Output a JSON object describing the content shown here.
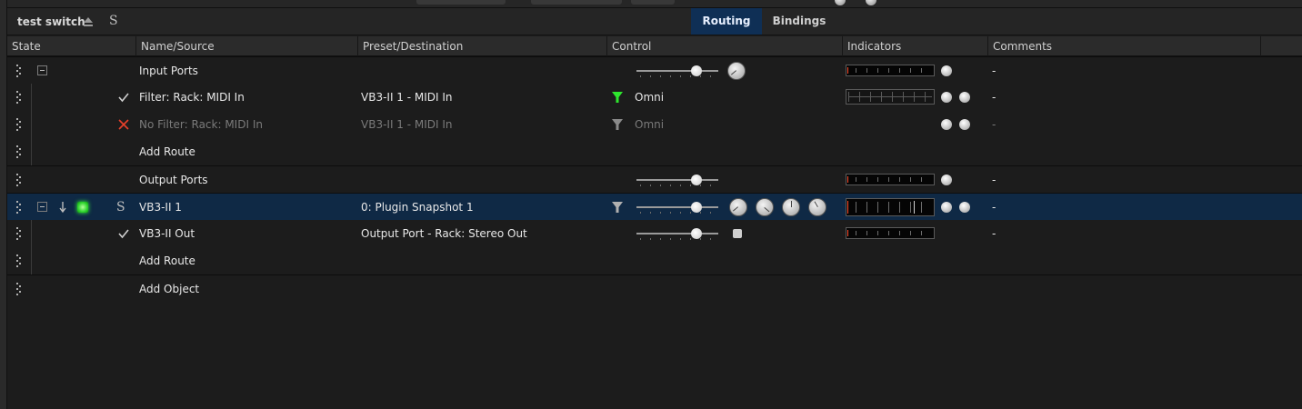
{
  "header": {
    "title": "test switch",
    "solo_label": "S",
    "tabs": [
      {
        "label": "Routing",
        "active": true
      },
      {
        "label": "Bindings",
        "active": false
      }
    ]
  },
  "columns": [
    "State",
    "Name/Source",
    "Preset/Destination",
    "Control",
    "Indicators",
    "Comments"
  ],
  "rows": [
    {
      "name": "Input Ports",
      "destination": "",
      "control": "",
      "comment": "-"
    },
    {
      "name": "Filter: Rack: MIDI In",
      "destination": "VB3-II 1 - MIDI In",
      "control": "Omni",
      "comment": "-"
    },
    {
      "name": "No Filter: Rack: MIDI In",
      "destination": "VB3-II 1 - MIDI In",
      "control": "Omni",
      "comment": "-"
    },
    {
      "name": "Add Route",
      "destination": "",
      "control": "",
      "comment": ""
    },
    {
      "name": "Output Ports",
      "destination": "",
      "control": "",
      "comment": "-"
    },
    {
      "name": "VB3-II 1",
      "solo": "S",
      "destination": "0: Plugin Snapshot 1",
      "control": "",
      "comment": "-"
    },
    {
      "name": "VB3-II Out",
      "destination": "Output Port - Rack: Stereo Out",
      "control": "",
      "comment": "-"
    },
    {
      "name": "Add Route",
      "destination": "",
      "control": "",
      "comment": ""
    },
    {
      "name": "Add Object",
      "destination": "",
      "control": "",
      "comment": ""
    }
  ],
  "sliders": {
    "input_ports": 0.72,
    "output_ports": 0.72,
    "vb3": 0.72,
    "vb3_out": 0.72
  },
  "colors": {
    "accent_tab": "#0f2f55",
    "selected_row": "#0f2945",
    "filter_active": "#2ee62e",
    "reject": "#e8402a",
    "led_green": "#2fd52f"
  },
  "icons": {
    "eject": "eject-icon",
    "check": "check-icon",
    "reject": "x-icon",
    "filter": "filter-icon",
    "drag": "drag-handle-icon",
    "collapse": "collapse-icon",
    "arrow": "arrow-down-icon"
  }
}
